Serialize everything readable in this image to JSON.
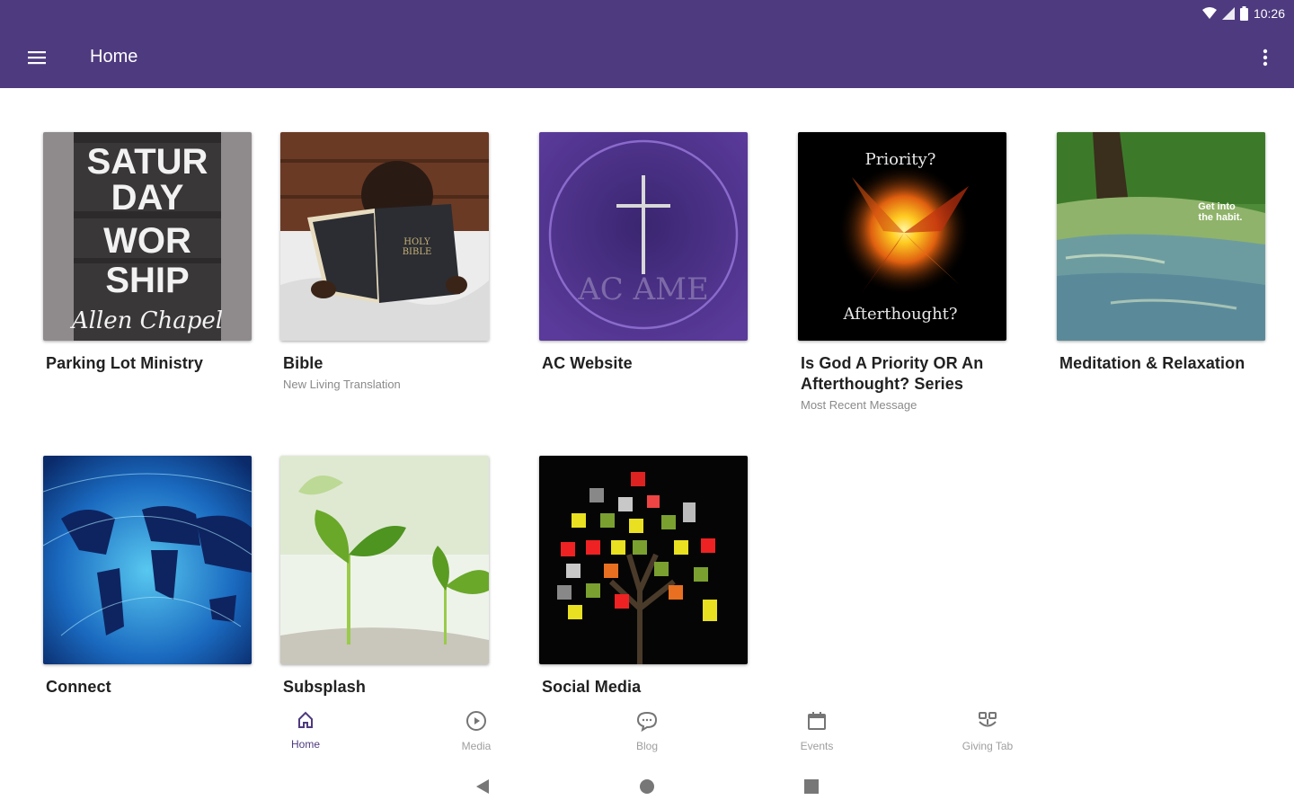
{
  "status_bar": {
    "time": "10:26",
    "icons": [
      "wifi-icon",
      "signal-icon",
      "battery-icon"
    ]
  },
  "app_bar": {
    "title": "Home",
    "menu_icon": "hamburger-menu-icon",
    "overflow_icon": "more-vert-icon",
    "color": "#4e3a7f"
  },
  "tiles": [
    {
      "title": "Parking Lot Ministry",
      "subtitle": "",
      "image_text": [
        "SATUR",
        "DAY",
        "WOR",
        "SHIP",
        "Allen Chapel"
      ]
    },
    {
      "title": "Bible",
      "subtitle": "New Living Translation",
      "image_text": [
        "HOLY",
        "BIBLE"
      ]
    },
    {
      "title": "AC Website",
      "subtitle": "",
      "image_text": [
        "AC AME"
      ]
    },
    {
      "title": "Is God A Priority OR An Afterthought? Series",
      "subtitle": "Most Recent Message",
      "image_text": [
        "Priority?",
        "Afterthought?"
      ]
    },
    {
      "title": "Meditation & Relaxation",
      "subtitle": "",
      "image_text": [
        "Get into",
        "the habit."
      ]
    },
    {
      "title": "Connect",
      "subtitle": "",
      "image_text": []
    },
    {
      "title": "Subsplash",
      "subtitle": "",
      "image_text": []
    },
    {
      "title": "Social Media",
      "subtitle": "",
      "image_text": []
    }
  ],
  "bottom_nav": [
    {
      "label": "Home",
      "icon": "home-icon",
      "active": true
    },
    {
      "label": "Media",
      "icon": "play-circle-icon",
      "active": false
    },
    {
      "label": "Blog",
      "icon": "chat-bubble-icon",
      "active": false
    },
    {
      "label": "Events",
      "icon": "calendar-icon",
      "active": false
    },
    {
      "label": "Giving Tab",
      "icon": "giving-icon",
      "active": false
    }
  ],
  "system_nav": [
    "back-icon",
    "home-circle-icon",
    "recents-icon"
  ]
}
